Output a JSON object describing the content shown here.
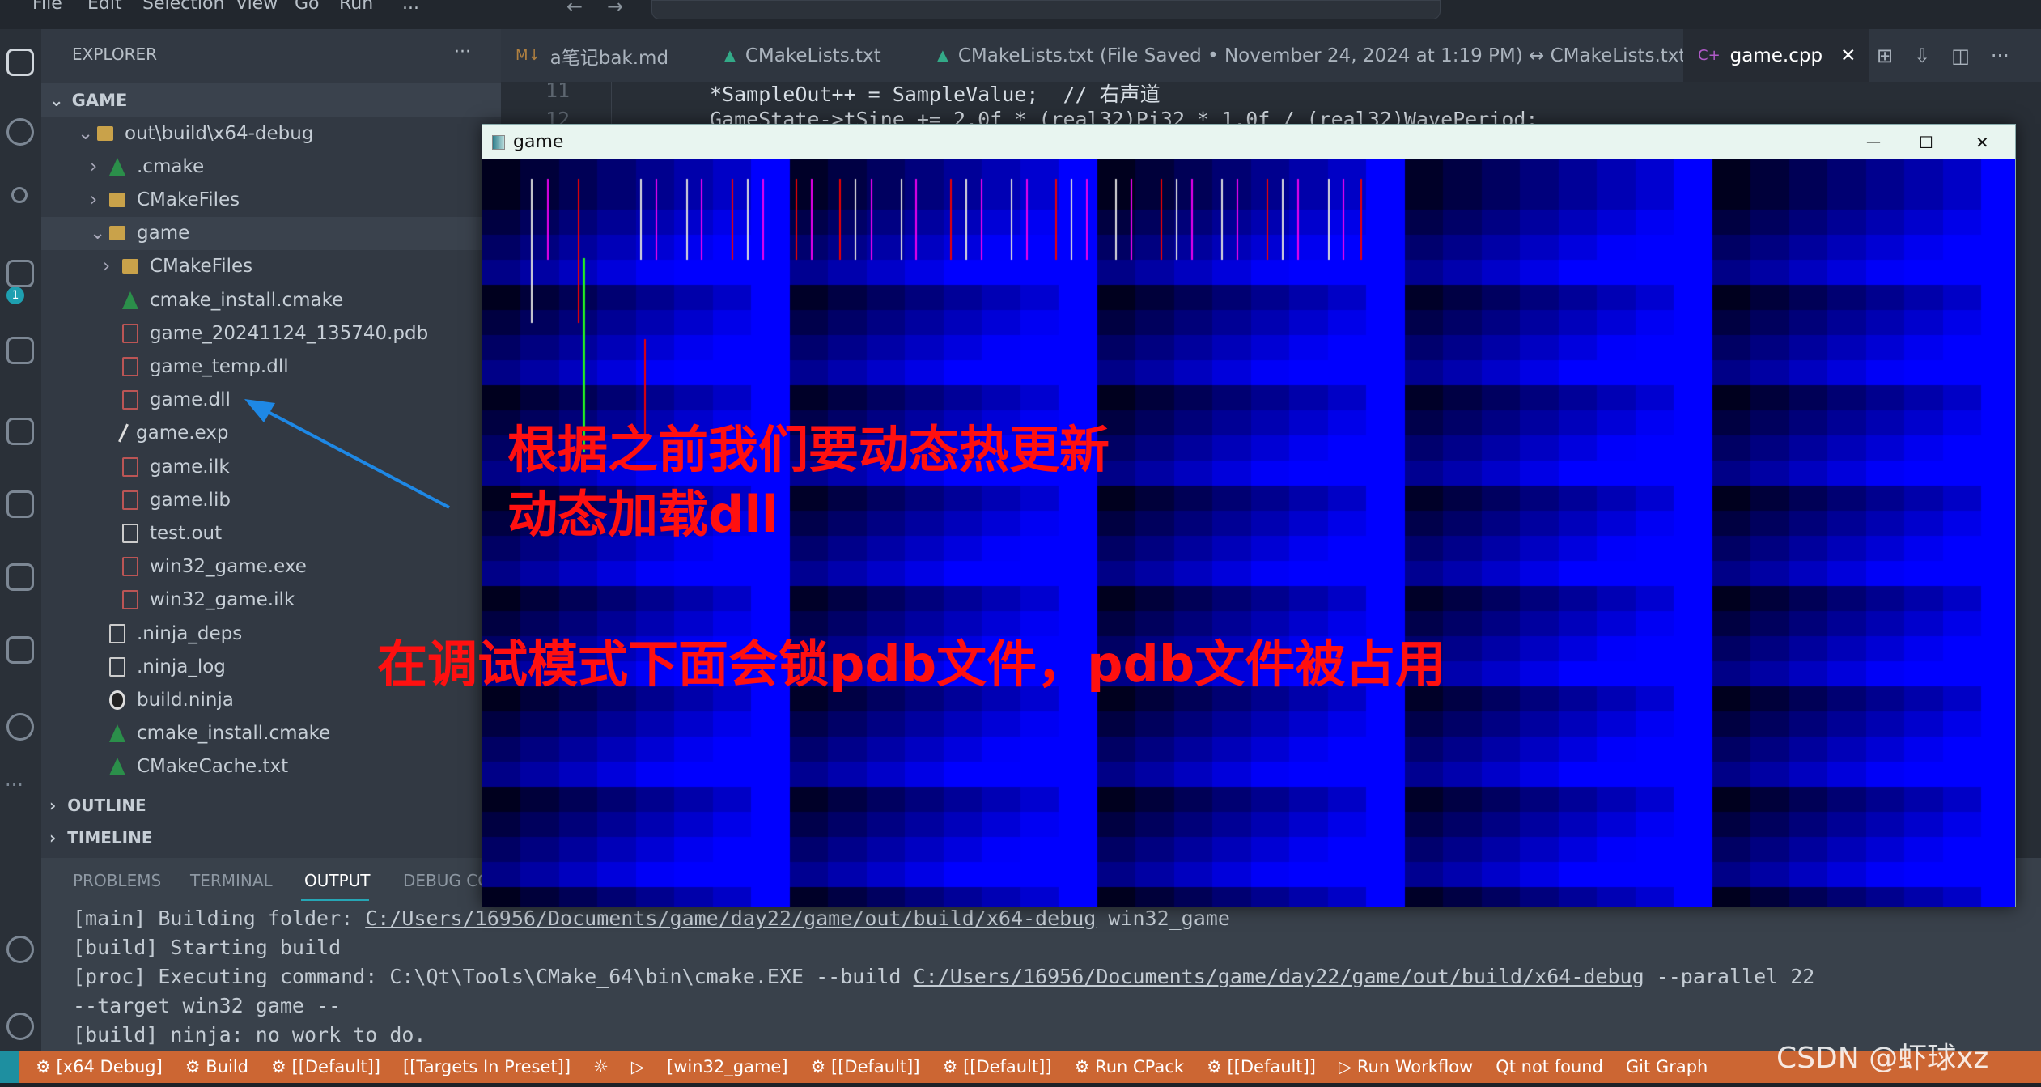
{
  "titlebar": {
    "menu": [
      "File",
      "Edit",
      "Selection",
      "View",
      "Go",
      "Run",
      "..."
    ]
  },
  "sidebar": {
    "title": "EXPLORER",
    "more": "···",
    "root": "GAME",
    "items": [
      {
        "label": "out\\build\\x64-debug",
        "level": 1,
        "kind": "folder",
        "open": true
      },
      {
        "label": ".cmake",
        "level": 2,
        "kind": "cmake-folder",
        "open": false
      },
      {
        "label": "CMakeFiles",
        "level": 2,
        "kind": "folder",
        "open": false
      },
      {
        "label": "game",
        "level": 2,
        "kind": "folder",
        "open": true
      },
      {
        "label": "CMakeFiles",
        "level": 3,
        "kind": "folder",
        "open": false
      },
      {
        "label": "cmake_install.cmake",
        "level": 3,
        "kind": "cmake"
      },
      {
        "label": "game_20241124_135740.pdb",
        "level": 3,
        "kind": "binary"
      },
      {
        "label": "game_temp.dll",
        "level": 3,
        "kind": "binary"
      },
      {
        "label": "game.dll",
        "level": 3,
        "kind": "binary"
      },
      {
        "label": "game.exp",
        "level": 3,
        "kind": "exp"
      },
      {
        "label": "game.ilk",
        "level": 3,
        "kind": "binary"
      },
      {
        "label": "game.lib",
        "level": 3,
        "kind": "binary"
      },
      {
        "label": "test.out",
        "level": 3,
        "kind": "file"
      },
      {
        "label": "win32_game.exe",
        "level": 3,
        "kind": "binary"
      },
      {
        "label": "win32_game.ilk",
        "level": 3,
        "kind": "binary"
      },
      {
        "label": ".ninja_deps",
        "level": 2,
        "kind": "file"
      },
      {
        "label": ".ninja_log",
        "level": 2,
        "kind": "file"
      },
      {
        "label": "build.ninja",
        "level": 2,
        "kind": "ninja"
      },
      {
        "label": "cmake_install.cmake",
        "level": 2,
        "kind": "cmake"
      },
      {
        "label": "CMakeCache.txt",
        "level": 2,
        "kind": "cmake"
      }
    ],
    "outline": "OUTLINE",
    "timeline": "TIMELINE"
  },
  "tabs": [
    {
      "label": "a笔记bak.md",
      "icon": "markdown-icon"
    },
    {
      "label": "CMakeLists.txt",
      "icon": "cmake-icon"
    },
    {
      "label": "CMakeLists.txt (File Saved • November 24, 2024 at 1:19 PM) ↔ CMakeLists.txt",
      "icon": "cmake-icon"
    },
    {
      "label": "game.cpp",
      "icon": "cpp-icon",
      "active": true,
      "close": "✕"
    }
  ],
  "editor": {
    "lines": [
      {
        "num": "11",
        "text": "*SampleOut++ = SampleValue;  // 右声道"
      },
      {
        "num": "12",
        "text": "GameState->tSine += 2.0f * (real32)Pi32 * 1.0f / (real32)WavePeriod;"
      }
    ]
  },
  "game_window": {
    "title": "game",
    "minimize": "—",
    "maximize": "☐",
    "close": "✕"
  },
  "annotations": {
    "line1": "根据之前我们要动态热更新",
    "line2": "动态加载dll",
    "line3": "在调试模式下面会锁pdb文件，pdb文件被占用",
    "arrow_color": "#1e88e5",
    "text_color": "#ff1010"
  },
  "panel": {
    "tabs": [
      "PROBLEMS",
      "TERMINAL",
      "OUTPUT",
      "DEBUG CO"
    ],
    "active": "OUTPUT",
    "lines": [
      [
        {
          "t": "[main] Building folder: "
        },
        {
          "t": "C:/Users/16956/Documents/game/day22/game/out/build/x64-debug",
          "link": true
        },
        {
          "t": " win32_game"
        }
      ],
      [
        {
          "t": "[build] Starting build"
        }
      ],
      [
        {
          "t": "[proc] Executing command: C:\\Qt\\Tools\\CMake_64\\bin\\cmake.EXE --build "
        },
        {
          "t": "C:/Users/16956/Documents/game/day22/game/out/build/x64-debug",
          "link": true
        },
        {
          "t": " --parallel 22"
        }
      ],
      [
        {
          "t": "--target win32_game --"
        }
      ],
      [
        {
          "t": "[build] ninja: no work to do."
        }
      ]
    ]
  },
  "status": {
    "color": "#cc6633",
    "items": [
      "⚙ [x64 Debug]",
      "⚙ Build",
      "⚙ [[Default]]",
      "[[Targets In Preset]]",
      "☼",
      "▷",
      "[win32_game]",
      "⚙ [[Default]]",
      "⚙ [[Default]]",
      "⚙ Run CPack",
      "⚙ [[Default]]",
      "▷ Run Workflow",
      "Qt not found",
      "Git Graph"
    ]
  },
  "watermark": "CSDN @虾球xz"
}
